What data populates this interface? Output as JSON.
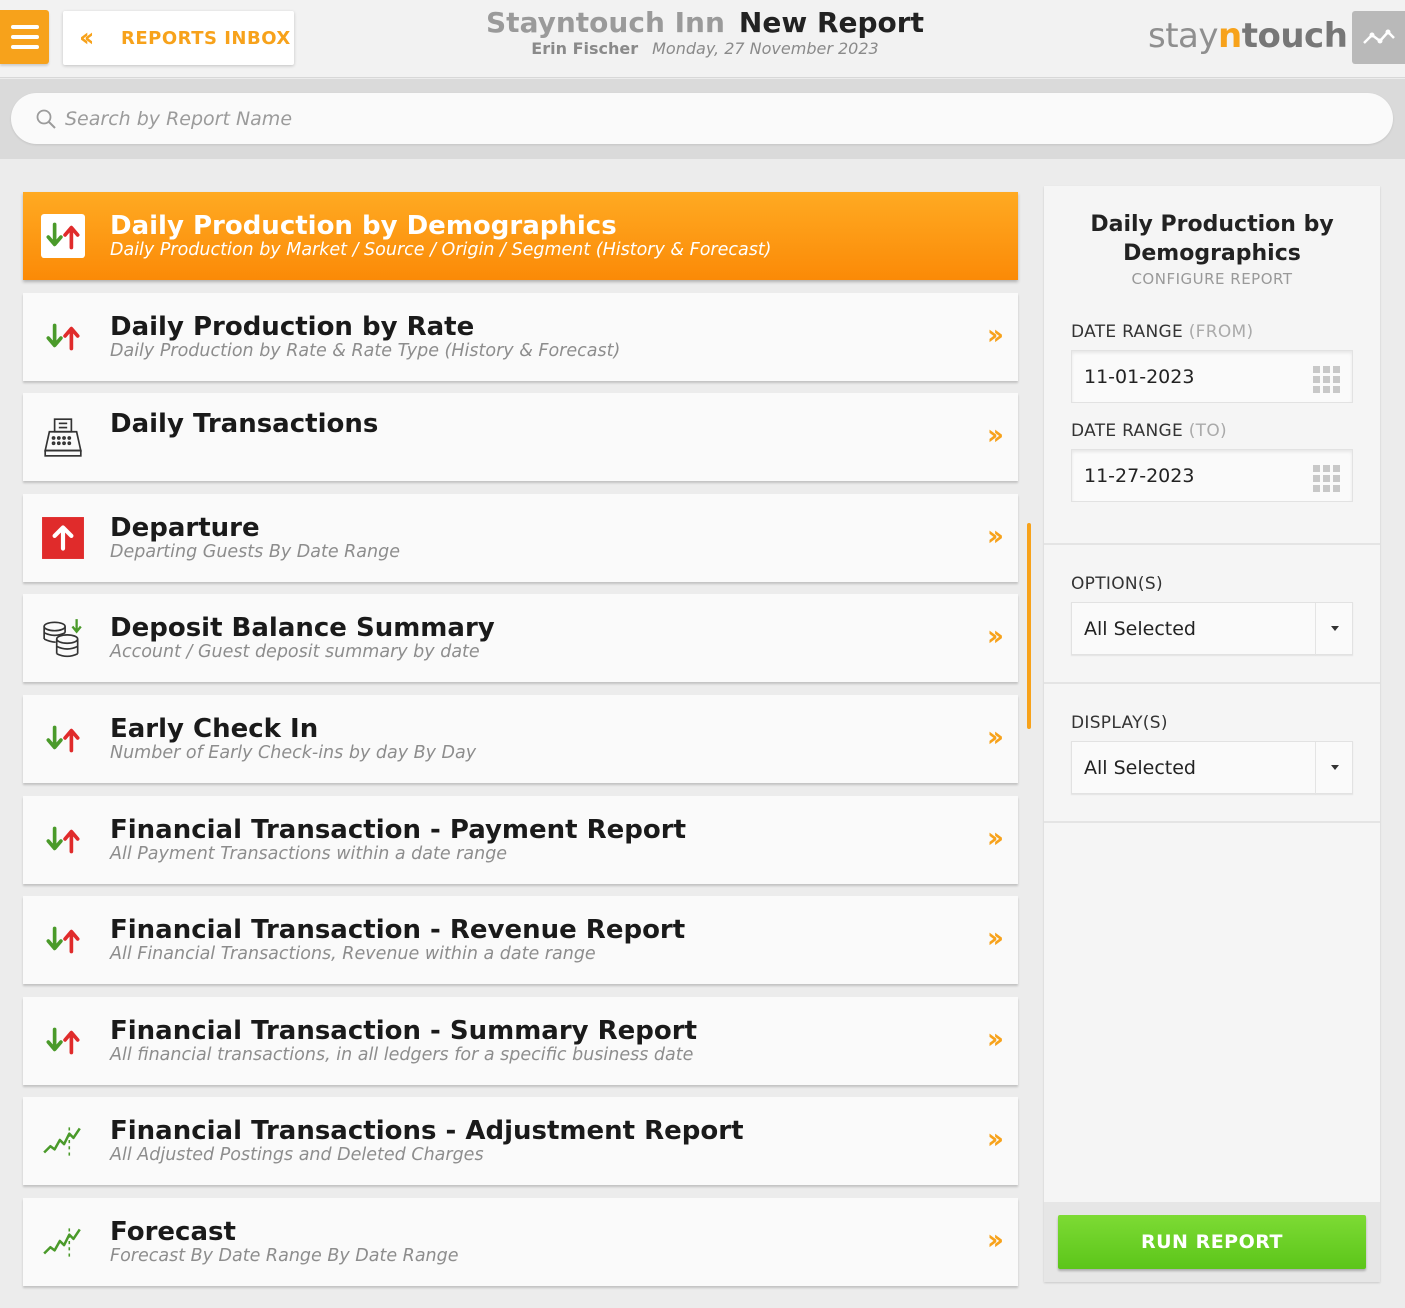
{
  "header": {
    "back_label": "REPORTS INBOX",
    "hotel_name": "Stayntouch Inn",
    "page_title": "New Report",
    "user": "Erin Fischer",
    "date": "Monday, 27 November 2023",
    "logo": {
      "stay": "stay",
      "n": "n",
      "touch": "touch"
    }
  },
  "search": {
    "placeholder": "Search by Report Name",
    "value": ""
  },
  "reports": [
    {
      "name": "Daily Production by Demographics",
      "desc": "Daily Production by Market / Source / Origin / Segment (History & Forecast)",
      "icon": "arrows-up-down-icon",
      "active": true
    },
    {
      "name": "Daily Production by Rate",
      "desc": "Daily Production by Rate & Rate Type (History & Forecast)",
      "icon": "arrows-up-down-icon"
    },
    {
      "name": "Daily Transactions",
      "desc": "",
      "icon": "cash-register-icon"
    },
    {
      "name": "Departure",
      "desc": "Departing Guests By Date Range",
      "icon": "departure-arrow-icon"
    },
    {
      "name": "Deposit Balance Summary",
      "desc": "Account / Guest deposit summary by date",
      "icon": "coins-icon"
    },
    {
      "name": "Early Check In",
      "desc": "Number of Early Check-ins by day By Day",
      "icon": "arrows-up-down-icon"
    },
    {
      "name": "Financial Transaction - Payment Report",
      "desc": "All Payment Transactions within a date range",
      "icon": "arrows-up-down-icon"
    },
    {
      "name": "Financial Transaction - Revenue Report",
      "desc": "All Financial Transactions, Revenue within a date range",
      "icon": "arrows-up-down-icon"
    },
    {
      "name": "Financial Transaction - Summary Report",
      "desc": "All financial transactions, in all ledgers for a specific business date",
      "icon": "arrows-up-down-icon"
    },
    {
      "name": "Financial Transactions - Adjustment Report",
      "desc": "All Adjusted Postings and Deleted Charges",
      "icon": "trend-line-icon"
    },
    {
      "name": "Forecast",
      "desc": "Forecast By Date Range By Date Range",
      "icon": "trend-line-icon"
    }
  ],
  "config": {
    "title": "Daily Production by Demographics",
    "subtitle": "CONFIGURE REPORT",
    "from_label": "DATE RANGE",
    "from_hint": "(FROM)",
    "from_value": "11-01-2023",
    "to_label": "DATE RANGE",
    "to_hint": "(TO)",
    "to_value": "11-27-2023",
    "options_label": "OPTION(S)",
    "options_value": "All Selected",
    "display_label": "DISPLAY(S)",
    "display_value": "All Selected",
    "run_label": "RUN REPORT"
  },
  "colors": {
    "accent": "#f7a21b",
    "run": "#6acd24",
    "down": "#4a9a2a",
    "up": "#e02b2b"
  }
}
